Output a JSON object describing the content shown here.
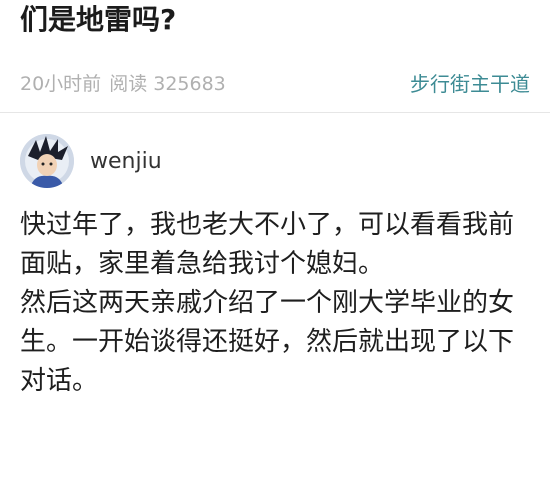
{
  "post": {
    "title": "们是地雷吗?",
    "time": "20小时前",
    "reads": "阅读 325683",
    "forum": "步行街主干道"
  },
  "author": {
    "name": "wenjiu",
    "avatar_icon": "anime-character-avatar"
  },
  "content": {
    "paragraphs": [
      "快过年了，我也老大不小了，可以看看我前面贴，家里着急给我讨个媳妇。",
      "然后这两天亲戚介绍了一个刚大学毕业的女生。一开始谈得还挺好，然后就出现了以下对话。"
    ]
  },
  "colors": {
    "forum_link": "#3d8b94",
    "meta_gray": "#b0b0b0",
    "body_text": "#1e1e1e"
  }
}
